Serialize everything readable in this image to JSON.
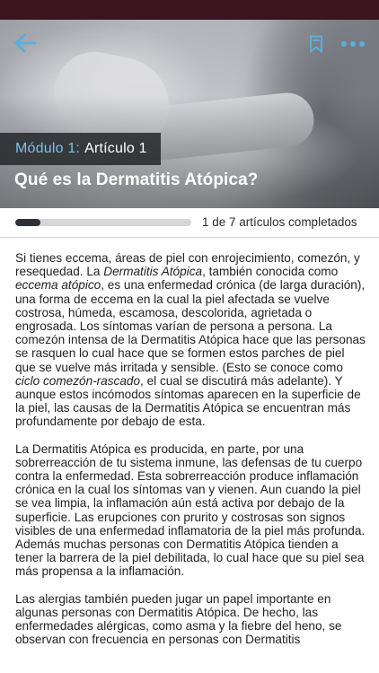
{
  "hero": {
    "module_key": "Módulo 1:",
    "module_value": "Artículo 1",
    "title": "Qué es la Dermatitis Atópica?"
  },
  "toolbar": {
    "back_icon": "arrow-left-icon",
    "bookmark_icon": "bookmark-icon",
    "more_icon": "more-dots-icon",
    "accent": "#5aaee0"
  },
  "progress": {
    "fraction": 0.143,
    "text": "1 de 7 artículos completados"
  },
  "article": {
    "p1": [
      "Si tienes eccema, áreas de piel con enrojecimiento, comezón, y resequedad. La ",
      "Dermatitis Atópica",
      ", también conocida como ",
      "eccema atópico",
      ", es una enfermedad crónica (de larga duración), una forma de eccema en la cual la piel afectada se vuelve costrosa, húmeda, escamosa, descolorida, agrietada o engrosada. Los síntomas varían de persona a persona. La comezón intensa de la Dermatitis Atópica hace que las personas se rasquen lo cual hace que se formen estos parches de piel que se vuelve más irritada y sensible. (Esto se conoce como ",
      "ciclo comezón-rascado",
      ", el cual se discutirá más adelante). Y aunque estos incómodos síntomas aparecen en la superficie de la piel, las causas de la Dermatitis Atópica se encuentran más profundamente por debajo de esta."
    ],
    "p2": "La Dermatitis Atópica es producida, en parte, por una sobrerreacción de tu sistema inmune, las defensas de tu cuerpo contra la enfermedad. Esta sobrerreacción produce inflamación crónica en la cual los síntomas van y vienen. Aun cuando la piel se vea limpia, la inflamación aún está activa por debajo de la superficie. Las erupciones con prurito y costrosas son signos visibles de una enfermedad inflamatoria de la piel más profunda. Además muchas personas con Dermatitis Atópica tienden a tener la barrera de la piel debilitada, lo cual hace que su piel sea más propensa a la inflamación.",
    "p3": "Las alergias también pueden jugar un papel importante en algunas personas con Dermatitis Atópica. De hecho, las enfermedades alérgicas, como asma y la fiebre del heno, se observan con frecuencia en personas con Dermatitis"
  }
}
